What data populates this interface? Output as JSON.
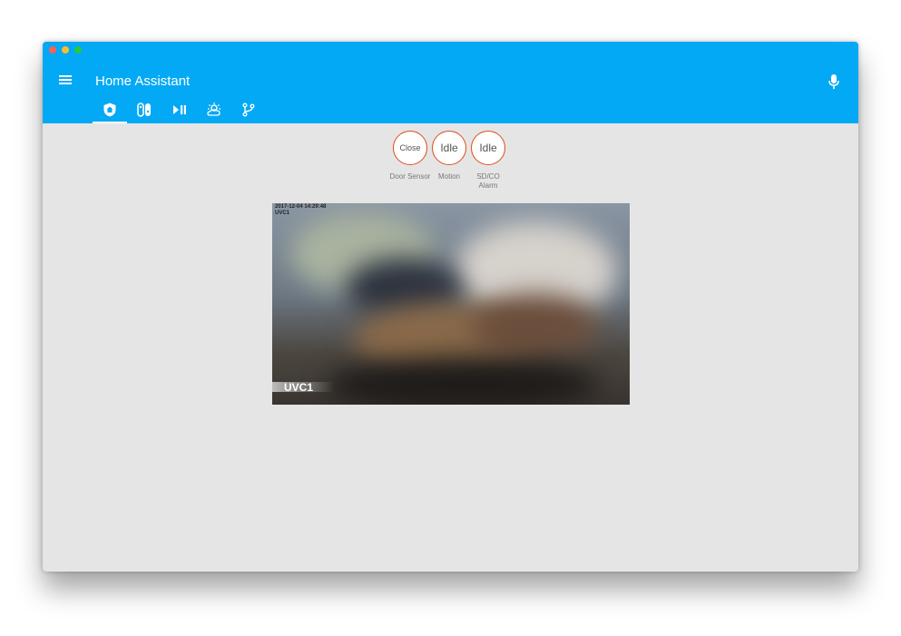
{
  "app": {
    "title": "Home Assistant"
  },
  "tabs": [
    {
      "icon": "home-shield-icon",
      "active": true
    },
    {
      "icon": "nintendo-switch-icon",
      "active": false
    },
    {
      "icon": "play-pause-icon",
      "active": false
    },
    {
      "icon": "weather-partly-cloudy-icon",
      "active": false
    },
    {
      "icon": "source-branch-icon",
      "active": false
    }
  ],
  "badges": [
    {
      "state": "Close",
      "label": "Door Sensor"
    },
    {
      "state": "Idle",
      "label": "Motion"
    },
    {
      "state": "Idle",
      "label": "SD/CO Alarm"
    }
  ],
  "camera": {
    "timestamp": "2017-12-04 14:29:48",
    "overlay_small": "UVC1",
    "name": "UVC1"
  },
  "colors": {
    "header": "#03a9f4",
    "badge_border": "#df4c1e",
    "background": "#e5e5e5"
  }
}
